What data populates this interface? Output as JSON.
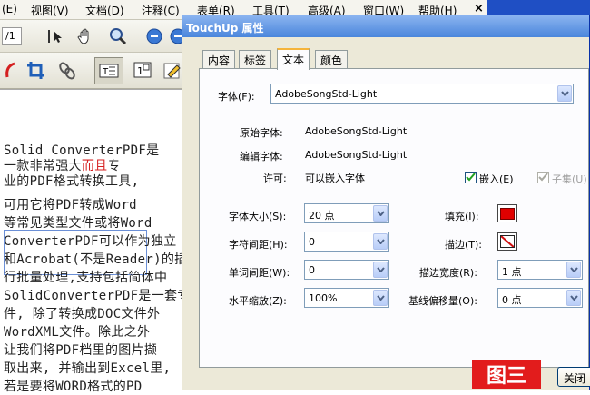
{
  "menubar": {
    "items": [
      "(E)",
      "视图(V)",
      "文档(D)",
      "注释(C)",
      "表单(R)",
      "工具(T)",
      "高级(A)",
      "窗口(W)",
      "帮助(H)"
    ],
    "close": "×"
  },
  "toolbar": {
    "page_value": "/1"
  },
  "document": {
    "box_lines": [
      "Solid ConverterPDF是",
      "专",
      "业的PDF格式转换工具,"
    ],
    "box_line2_pre": "一款非常强大",
    "box_line2_red": "而且",
    "lines": [
      "可用它将PDF转成Word",
      "等常见类型文件或将Word",
      "ConverterPDF可以作为独立",
      "和Acrobat(不是Reader)的插",
      "行批量处理,支持包括简体中",
      "SolidConverterPDF是一套专",
      "件, 除了转换成DOC文件外",
      "WordXML文件。除此之外",
      "让我们将PDF档里的图片撷",
      "取出来, 并输出到Excel里,",
      "若是要将WORD格式的PD"
    ]
  },
  "dialog": {
    "title": "TouchUp 属性",
    "tabs": [
      "内容",
      "标签",
      "文本",
      "颜色"
    ],
    "active_tab": "文本",
    "font_label": "字体(F):",
    "font_value": "AdobeSongStd-Light",
    "original_font_label": "原始字体:",
    "original_font_value": "AdobeSongStd-Light",
    "edit_font_label": "编辑字体:",
    "edit_font_value": "AdobeSongStd-Light",
    "permission_label": "许可:",
    "permission_value": "可以嵌入字体",
    "embed_label": "嵌入(E)",
    "embed_checked": true,
    "subset_label": "子集(U)",
    "subset_checked": true,
    "font_size_label": "字体大小(S):",
    "font_size_value": "20 点",
    "char_spacing_label": "字符间距(H):",
    "char_spacing_value": "0",
    "word_spacing_label": "单词间距(W):",
    "word_spacing_value": "0",
    "horiz_scale_label": "水平缩放(Z):",
    "horiz_scale_value": "100%",
    "fill_label": "填充(I):",
    "fill_color": "#e00000",
    "stroke_label": "描边(T):",
    "stroke_width_label": "描边宽度(R):",
    "stroke_width_value": "1 点",
    "baseline_label": "基线偏移量(O):",
    "baseline_value": "0 点",
    "close_button": "关闭"
  },
  "figure_label": "图三"
}
